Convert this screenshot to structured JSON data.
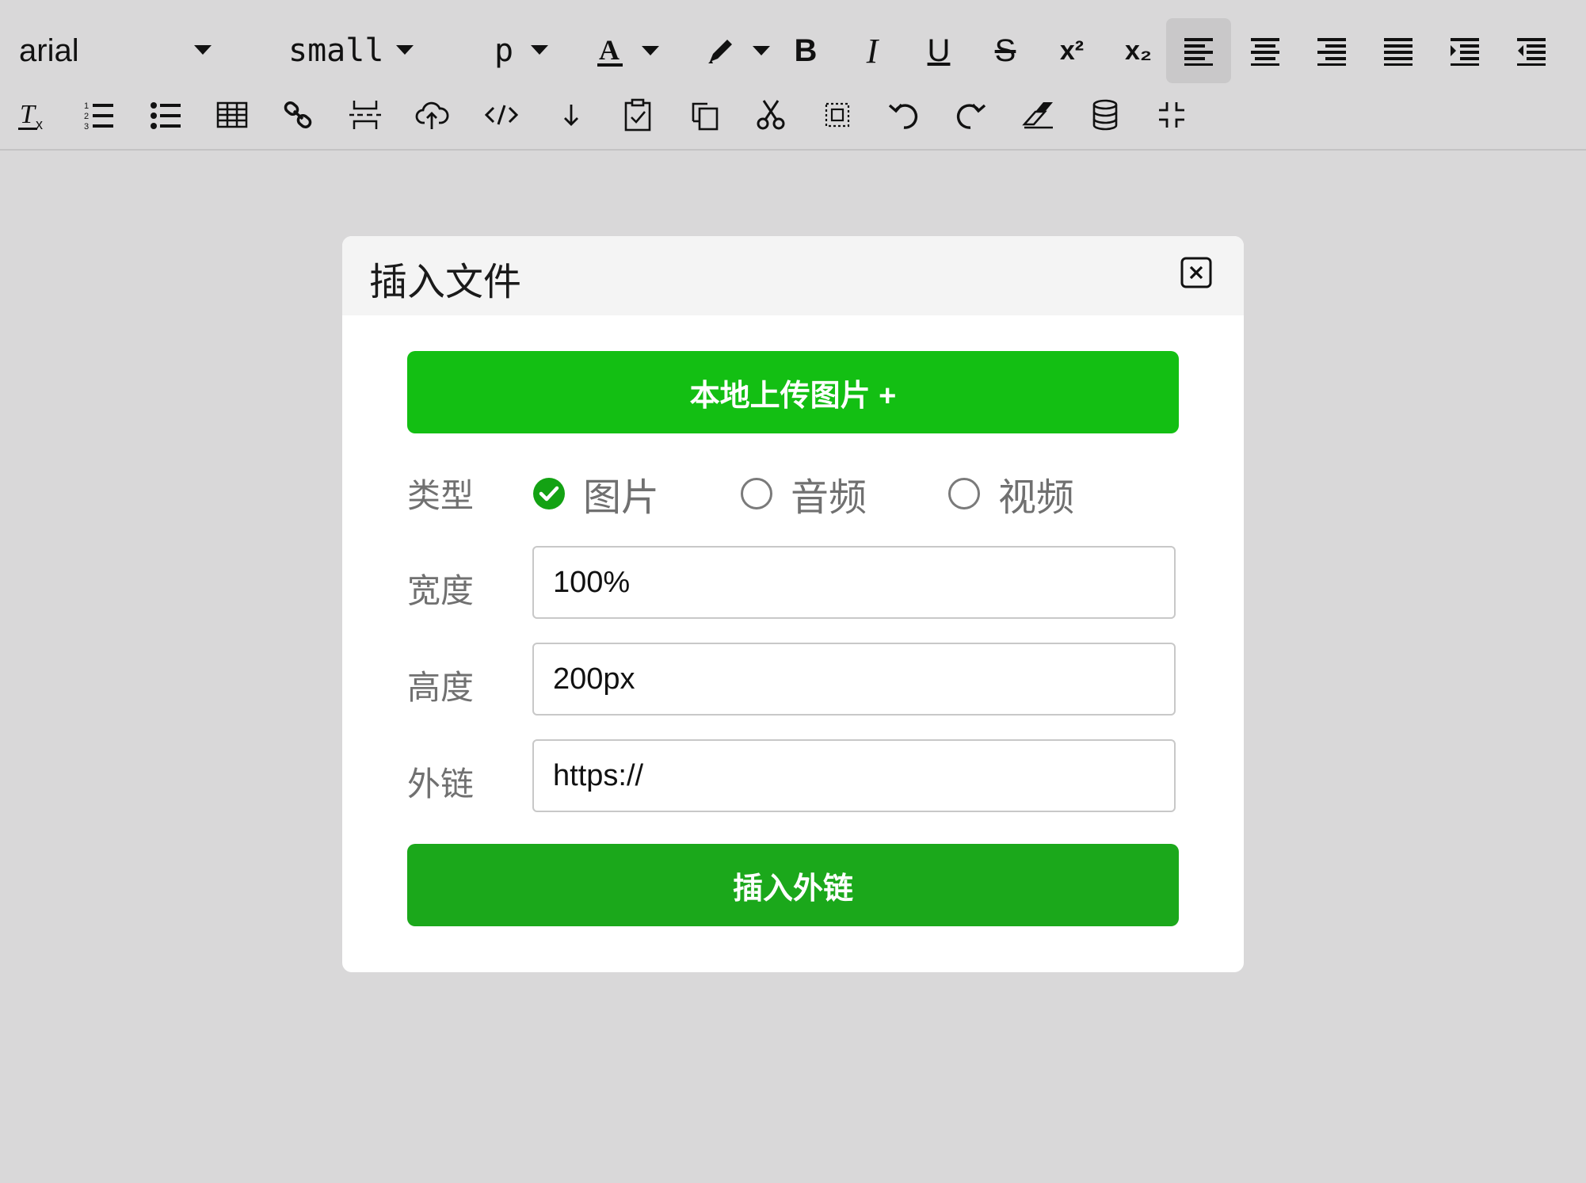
{
  "toolbar": {
    "font_family": "arial",
    "font_size": "small",
    "block_format": "p",
    "bold_label": "B",
    "italic_label": "I",
    "underline_label": "U",
    "strike_label": "S",
    "superscript_label": "x²",
    "subscript_label": "x₂",
    "active_tool": "align-left",
    "icons_row1": [
      "font-color-icon",
      "highlight-icon",
      "bold-icon",
      "italic-icon",
      "underline-icon",
      "strikethrough-icon",
      "superscript-icon",
      "subscript-icon",
      "align-left-icon",
      "align-center-icon",
      "align-right-icon",
      "align-justify-icon",
      "indent-icon",
      "outdent-icon"
    ],
    "icons_row2": [
      "clear-format-icon",
      "ordered-list-icon",
      "unordered-list-icon",
      "table-icon",
      "link-icon",
      "page-break-icon",
      "upload-cloud-icon",
      "code-icon",
      "arrow-down-icon",
      "paste-icon",
      "copy-icon",
      "cut-icon",
      "select-all-icon",
      "undo-icon",
      "redo-icon",
      "eraser-icon",
      "database-icon",
      "collapse-icon"
    ]
  },
  "dialog": {
    "title": "插入文件",
    "upload_button": "本地上传图片 +",
    "type_label": "类型",
    "type_options": [
      {
        "label": "图片",
        "checked": true
      },
      {
        "label": "音频",
        "checked": false
      },
      {
        "label": "视频",
        "checked": false
      }
    ],
    "width_label": "宽度",
    "width_value": "100%",
    "height_label": "高度",
    "height_value": "200px",
    "link_label": "外链",
    "link_value": "https://",
    "insert_button": "插入外链"
  },
  "colors": {
    "accent_green": "#13bf13",
    "button_green": "#1ba81b",
    "background": "#d9d8d9"
  }
}
